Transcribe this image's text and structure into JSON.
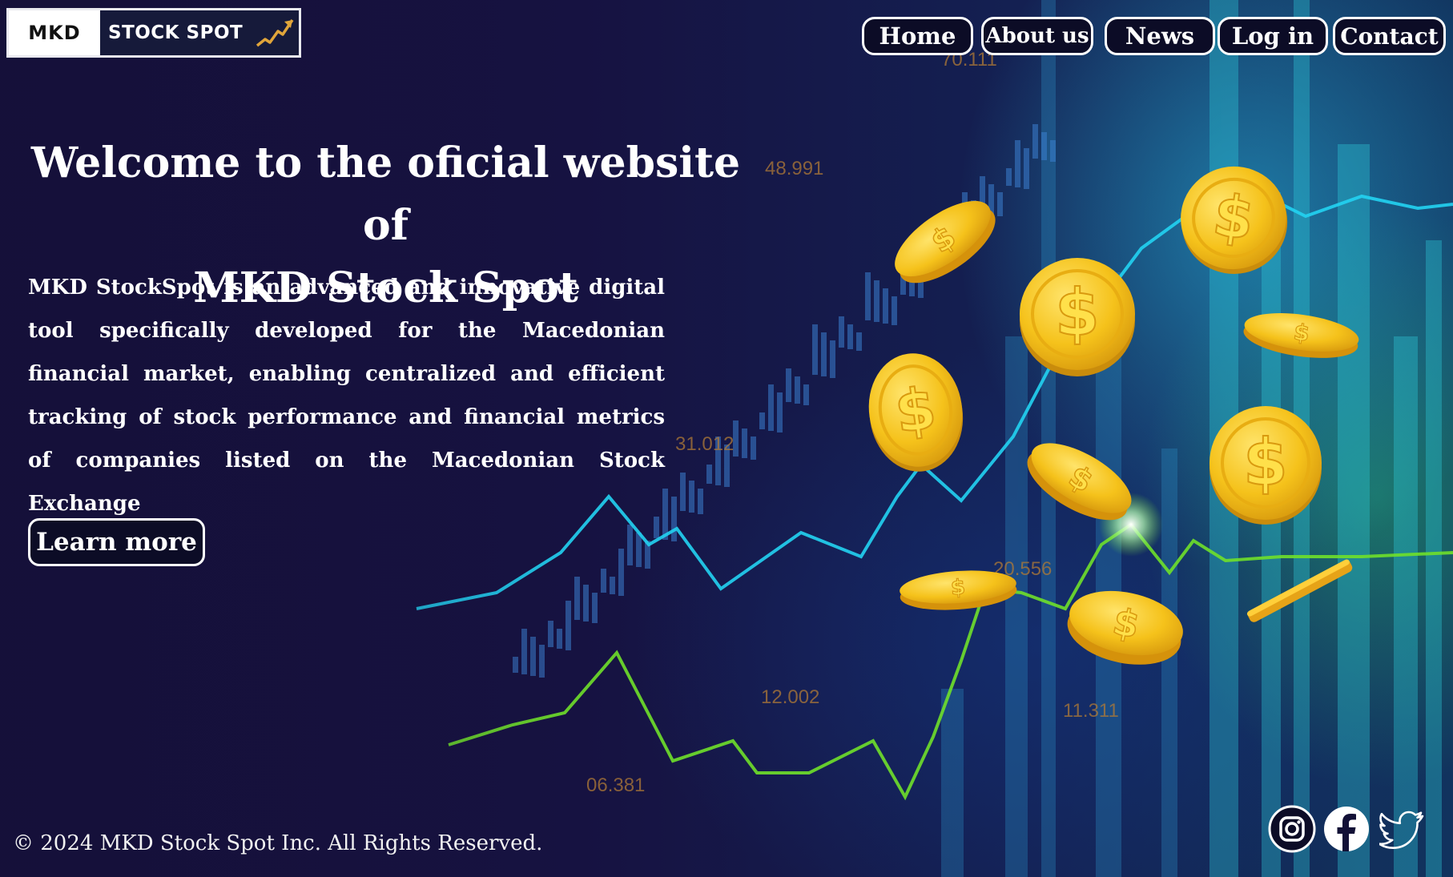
{
  "logo": {
    "left_text": "MKD",
    "right_text": "STOCK SPOT"
  },
  "nav": {
    "home": "Home",
    "about": "About us",
    "news": "News",
    "login": "Log in",
    "contact": "Contact"
  },
  "hero": {
    "title_line1": "Welcome to the oficial website of",
    "title_line2": "MKD Stock Spot",
    "description": "MKD StockSpot is an advanced and innovative digital tool specifically developed for the Macedonian financial market, enabling centralized and efficient tracking of stock performance and financial metrics of companies listed on the Macedonian Stock Exchange",
    "cta": "Learn more"
  },
  "background_chart_numbers": [
    "70.111",
    "48.991",
    "31.012",
    "20.556",
    "12.002",
    "11.311",
    "06.381"
  ],
  "footer": {
    "copyright_symbol": "©",
    "copyright": "2024 MKD Stock Spot Inc. All Rights Reserved."
  },
  "social": [
    "instagram-icon",
    "facebook-icon",
    "twitter-icon"
  ],
  "colors": {
    "background": "#121036",
    "button_bg": "#0c0c26",
    "button_border": "#ffffff",
    "coin": "#f5c21b",
    "line_cyan": "#22d3f2",
    "line_green": "#6fe02a",
    "chart_numbers": "#b07a36"
  }
}
